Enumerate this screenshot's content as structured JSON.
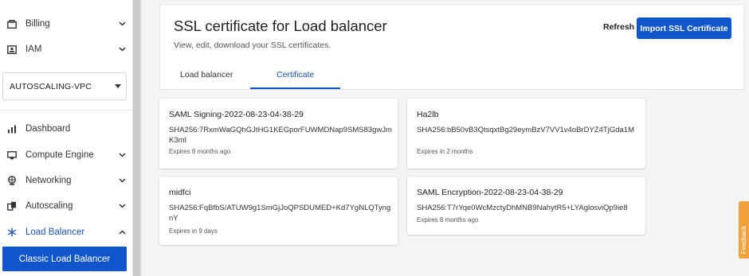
{
  "sidebar": {
    "items": [
      {
        "label": "Billing",
        "icon": "billing-icon"
      },
      {
        "label": "IAM",
        "icon": "id-card-icon"
      },
      {
        "label": "Dashboard",
        "icon": "bar-chart-icon"
      },
      {
        "label": "Compute Engine",
        "icon": "monitor-icon"
      },
      {
        "label": "Networking",
        "icon": "globe-icon"
      },
      {
        "label": "Autoscaling",
        "icon": "autoscaling-icon"
      },
      {
        "label": "Load Balancer",
        "icon": "snowflake-icon"
      }
    ],
    "vpc_select": "AUTOSCALING-VPC",
    "sub_item": "Classic Load Balancer"
  },
  "header": {
    "title": "SSL certificate for Load balancer",
    "subtitle": "View, edit, download your SSL certificates.",
    "refresh_label": "Refresh",
    "import_label": "Import SSL Certificate"
  },
  "tabs": [
    {
      "label": "Load balancer",
      "active": false
    },
    {
      "label": "Certificate",
      "active": true
    }
  ],
  "certificates": [
    {
      "name": "SAML Signing-2022-08-23-04-38-29",
      "sha": "SHA256:7RxmWaGQhGJtHG1KEGporFUWMDNap9SMS83gwJmK3mI",
      "expires": "Expires 8 months ago"
    },
    {
      "name": "Ha2lb",
      "sha": "SHA256:bB50vB3QtsqxtBg29eymBzV7VV1v4oBrDYZ4TjGda1M",
      "expires": "Expires in 2 months"
    },
    {
      "name": "midfci",
      "sha": "SHA256:FqBfbS/ATUW9g1SmGjJoQPSDUMED+Kd7YgNLQTyngnY",
      "expires": "Expires in 9 days"
    },
    {
      "name": "SAML Encryption-2022-08-23-04-38-29",
      "sha": "SHA256:T7rYqe0WcMzctyDhMNB9NahytR5+LYAglosviQp9ie8",
      "expires": "Expires 8 months ago"
    }
  ],
  "feedback_label": "Feedback",
  "colors": {
    "primary": "#1155cc",
    "feedback": "#f2a23a",
    "active_text": "#1a56b8"
  }
}
